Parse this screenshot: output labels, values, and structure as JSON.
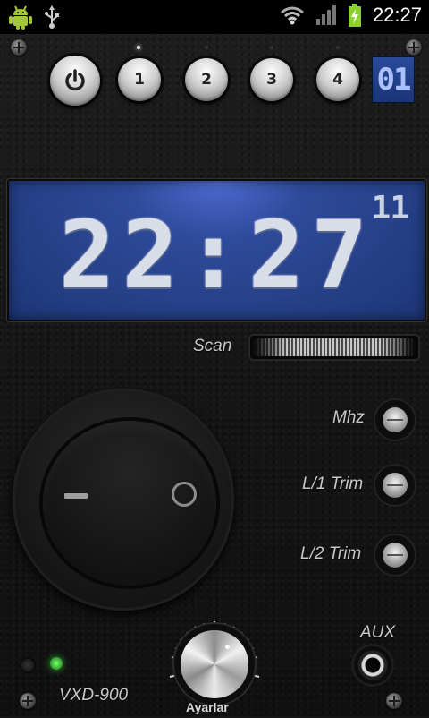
{
  "status_bar": {
    "time": "22:27",
    "icons": [
      "android-icon",
      "usb-icon",
      "wifi-icon",
      "signal-icon",
      "battery-charging-icon"
    ]
  },
  "presets": {
    "buttons": [
      "1",
      "2",
      "3",
      "4"
    ],
    "active_index": 0,
    "display": "01"
  },
  "lcd": {
    "time": "22:27",
    "seconds": "11"
  },
  "controls": {
    "scan_label": "Scan",
    "mhz_label": "Mhz",
    "l1_trim_label": "L/1 Trim",
    "l2_trim_label": "L/2 Trim",
    "aux_label": "AUX",
    "dial_label": "Ayarlar",
    "model_label": "VXD-900"
  },
  "colors": {
    "lcd_blue": "#2f4a9a",
    "led_green": "#3fb53f"
  }
}
